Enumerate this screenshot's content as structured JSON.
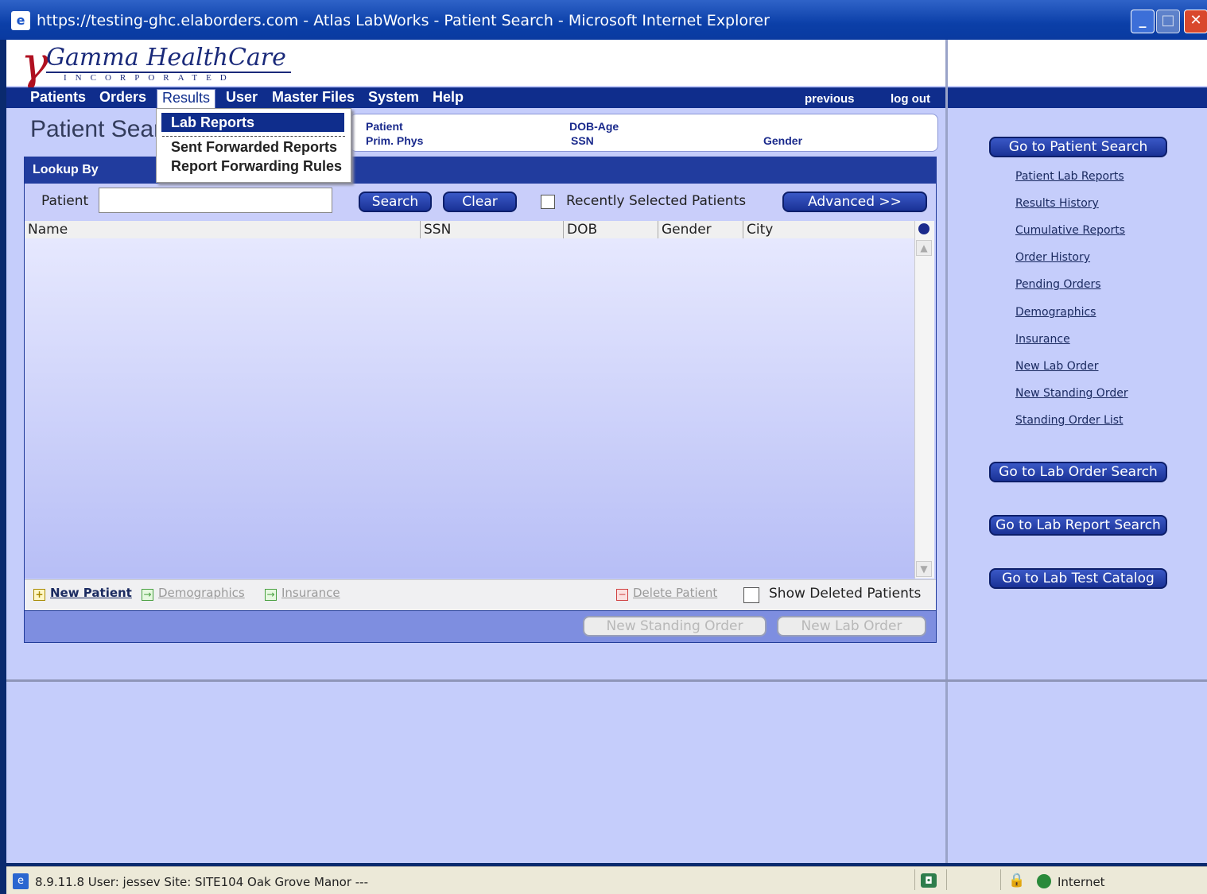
{
  "window": {
    "title": "https://testing-ghc.elaborders.com - Atlas LabWorks - Patient Search - Microsoft Internet Explorer",
    "min": "_",
    "max": "□",
    "close": "✕"
  },
  "logo": {
    "name": "Gamma HealthCare",
    "inc": "INCORPORATED"
  },
  "menu": {
    "items": [
      "Patients",
      "Orders",
      "Results",
      "User",
      "Master Files",
      "System",
      "Help"
    ],
    "previous": "previous",
    "logout": "log out"
  },
  "dropdown": {
    "items": [
      "Lab Reports",
      "Sent Forwarded Reports",
      "Report Forwarding Rules"
    ]
  },
  "header": {
    "title": "Patient Search",
    "patient_label": "Patient",
    "prim_phys_label": "Prim. Phys",
    "dob_age_label": "DOB-Age",
    "ssn_label": "SSN",
    "gender_label": "Gender"
  },
  "lookup": {
    "title": "Lookup By",
    "patient_label": "Patient",
    "patient_value": "",
    "search_label": "Search",
    "clear_label": "Clear",
    "recent_label": "Recently Selected Patients",
    "advanced_label": "Advanced >>"
  },
  "grid": {
    "columns": [
      "Name",
      "SSN",
      "DOB",
      "Gender",
      "City"
    ],
    "rows": []
  },
  "actions": {
    "new_patient": "New Patient",
    "demographics": "Demographics",
    "insurance": "Insurance",
    "delete_patient": "Delete Patient",
    "show_deleted": "Show Deleted Patients",
    "new_standing_order": "New Standing Order",
    "new_lab_order": "New Lab Order"
  },
  "right_panel": {
    "go_patient_search": "Go to Patient Search",
    "links": [
      "Patient Lab Reports",
      "Results History",
      "Cumulative Reports",
      "Order History",
      "Pending Orders",
      "Demographics",
      "Insurance",
      "New Lab Order",
      "New Standing Order",
      "Standing Order List"
    ],
    "go_lab_order_search": "Go to Lab Order Search",
    "go_lab_report_search": "Go to Lab Report Search",
    "go_lab_test_catalog": "Go to Lab Test Catalog"
  },
  "status": {
    "text": "8.9.11.8   User: jessev     Site: SITE104  Oak Grove Manor ---",
    "zone": "Internet"
  },
  "colors": {
    "menu_bar": "#0f2d8c",
    "frame": "#c5cdfb",
    "button": "#1a3296"
  }
}
